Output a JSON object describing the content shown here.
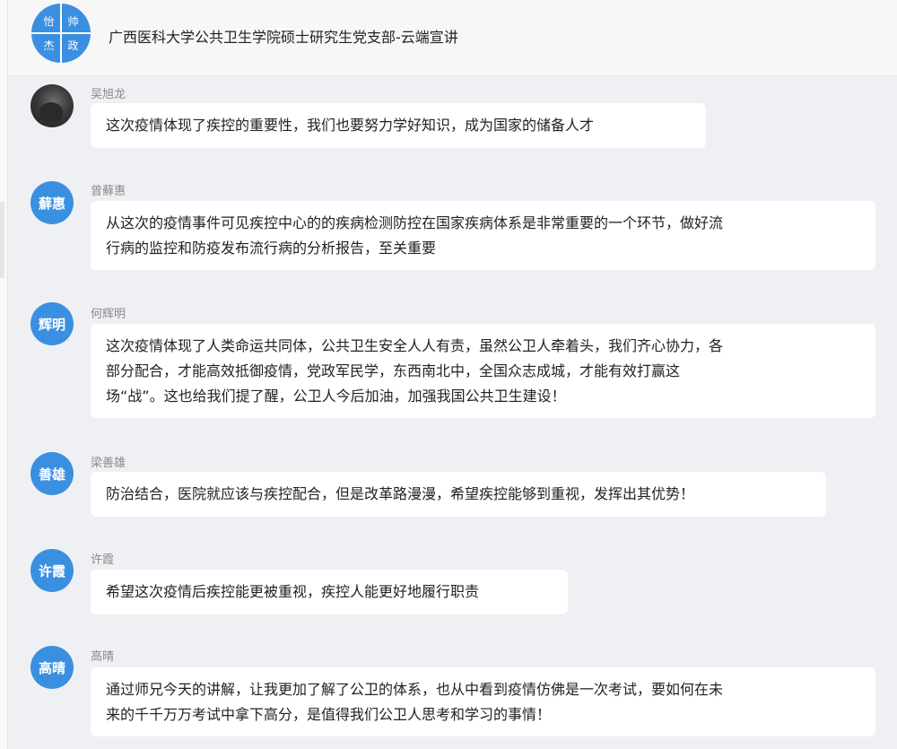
{
  "header": {
    "title": "广西医科大学公共卫生学院硕士研究生党支部-云端宣讲",
    "group_avatar_chars": [
      "怡",
      "帅",
      "杰",
      "政"
    ]
  },
  "colors": {
    "avatar_blue": "#3b8fe0",
    "background": "#eef0f4",
    "bubble": "#ffffff"
  },
  "messages": [
    {
      "sender": "吴旭龙",
      "avatar_text": "",
      "avatar_type": "photo",
      "lines": [
        "这次疫情体现了疾控的重要性，我们也要努力学好知识，成为国家的储备人才"
      ]
    },
    {
      "sender": "曾蘚惠",
      "avatar_text": "蘚惠",
      "avatar_type": "text",
      "lines": [
        "从这次的疫情事件可见疾控中心的的疾病检测防控在国家疾病体系是非常重要的一个环节，做好流",
        "行病的监控和防疫发布流行病的分析报告，至关重要"
      ]
    },
    {
      "sender": "何辉明",
      "avatar_text": "辉明",
      "avatar_type": "text",
      "lines": [
        "这次疫情体现了人类命运共同体，公共卫生安全人人有责，虽然公卫人牵着头，我们齐心协力，各",
        "部分配合，才能高效抵御疫情，党政军民学，东西南北中，全国众志成城，才能有效打赢这",
        "场“战”。这也给我们提了醒，公卫人今后加油，加强我国公共卫生建设！"
      ]
    },
    {
      "sender": "梁善雄",
      "avatar_text": "善雄",
      "avatar_type": "text",
      "lines": [
        "防治结合，医院就应该与疾控配合，但是改革路漫漫，希望疾控能够到重视，发挥出其优势！"
      ]
    },
    {
      "sender": "许霞",
      "avatar_text": "许霞",
      "avatar_type": "text",
      "lines": [
        "希望这次疫情后疾控能更被重视，疾控人能更好地履行职责"
      ]
    },
    {
      "sender": "高晴",
      "avatar_text": "高晴",
      "avatar_type": "text",
      "lines": [
        "通过师兄今天的讲解，让我更加了解了公卫的体系，也从中看到疫情仿佛是一次考试，要如何在未",
        "来的千千万万考试中拿下高分，是值得我们公卫人思考和学习的事情！"
      ]
    }
  ]
}
